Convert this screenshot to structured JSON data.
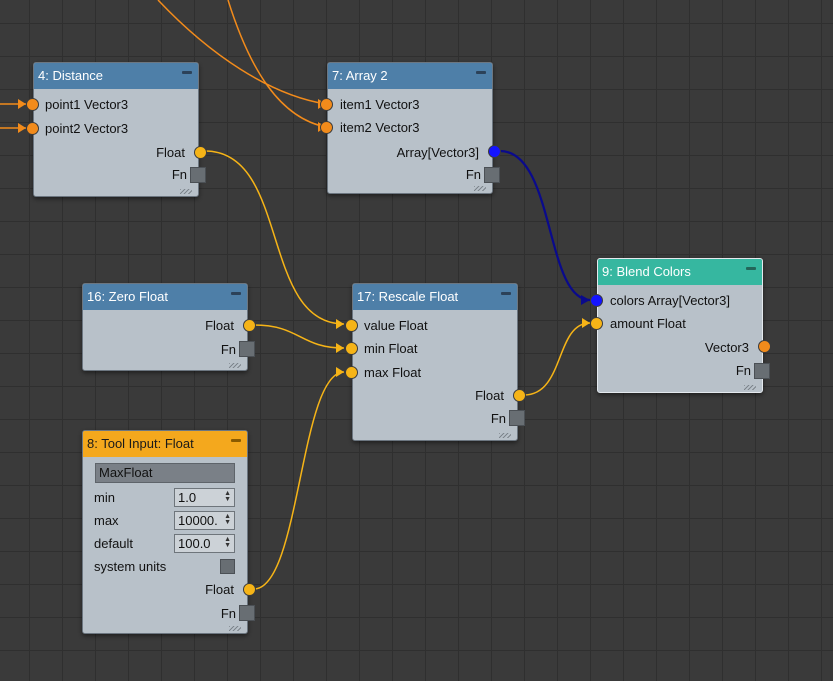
{
  "colors": {
    "canvas": "#3a3a3a",
    "node_body": "#b8c1c9",
    "header_blue": "#4e7fa8",
    "header_teal": "#36b7a0",
    "header_orange": "#f4a81d",
    "port_orange": "#f28b1b",
    "port_yellow": "#f6b417",
    "port_blue": "#1414ff",
    "wire_orange": "#f28b1b",
    "wire_yellow": "#f6b417",
    "wire_blue": "#0a0a8c"
  },
  "nodes": {
    "distance": {
      "title": "4: Distance",
      "in1": "point1 Vector3",
      "in2": "point2 Vector3",
      "out": "Float",
      "fn": "Fn"
    },
    "array2": {
      "title": "7: Array 2",
      "in1": "item1 Vector3",
      "in2": "item2 Vector3",
      "out": "Array[Vector3]",
      "fn": "Fn"
    },
    "blend": {
      "title": "9: Blend Colors",
      "in1": "colors Array[Vector3]",
      "in2": "amount Float",
      "out": "Vector3",
      "fn": "Fn"
    },
    "zero": {
      "title": "16: Zero Float",
      "out": "Float",
      "fn": "Fn"
    },
    "rescale": {
      "title": "17: Rescale Float",
      "in1": "value Float",
      "in2": "min Float",
      "in3": "max Float",
      "out": "Float",
      "fn": "Fn"
    },
    "tool": {
      "title": "8: Tool Input: Float",
      "name_value": "MaxFloat",
      "min_label": "min",
      "min_value": "1.0",
      "max_label": "max",
      "max_value": "10000.",
      "default_label": "default",
      "default_value": "100.0",
      "system_units_label": "system units",
      "out": "Float",
      "fn": "Fn"
    }
  }
}
